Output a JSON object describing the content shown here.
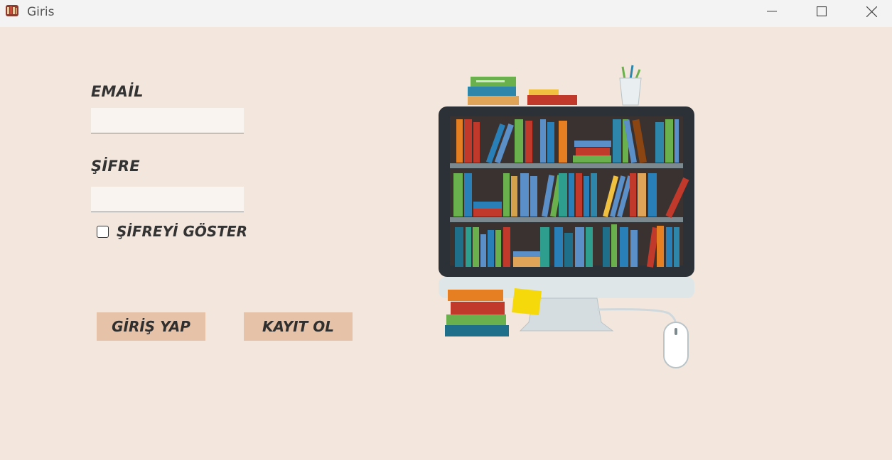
{
  "window": {
    "title": "Giris",
    "controls": [
      "minimize-icon",
      "maximize-icon",
      "close-icon"
    ]
  },
  "form": {
    "email_label": "EMAİL",
    "email_value": "",
    "password_label": "ŞİFRE",
    "password_value": "",
    "show_password_label": "ŞİFREYİ GÖSTER",
    "show_password_checked": false
  },
  "buttons": {
    "login_label": "GİRİŞ YAP",
    "register_label": "KAYIT OL"
  },
  "colors": {
    "background": "#f3e6dd",
    "button": "#e6c2a8",
    "field": "#faf4f0"
  },
  "illustration": "computer-bookshelf-illustration"
}
